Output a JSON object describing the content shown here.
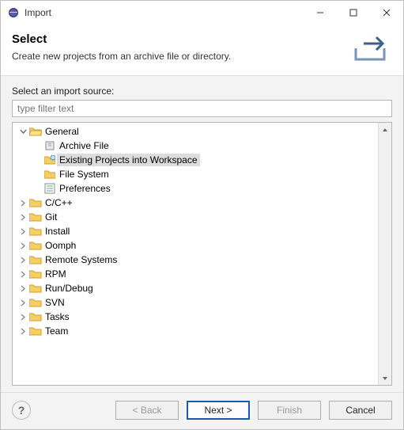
{
  "window": {
    "title": "Import"
  },
  "banner": {
    "heading": "Select",
    "subheading": "Create new projects from an archive file or directory."
  },
  "content": {
    "label": "Select an import source:",
    "filter_placeholder": "type filter text"
  },
  "tree": {
    "general": {
      "label": "General",
      "children": [
        {
          "label": "Archive File",
          "icon": "archive-file-icon"
        },
        {
          "label": "Existing Projects into Workspace",
          "icon": "projects-icon",
          "selected": true
        },
        {
          "label": "File System",
          "icon": "file-system-icon"
        },
        {
          "label": "Preferences",
          "icon": "preferences-icon"
        }
      ]
    },
    "folders": [
      {
        "label": "C/C++"
      },
      {
        "label": "Git"
      },
      {
        "label": "Install"
      },
      {
        "label": "Oomph"
      },
      {
        "label": "Remote Systems"
      },
      {
        "label": "RPM"
      },
      {
        "label": "Run/Debug"
      },
      {
        "label": "SVN"
      },
      {
        "label": "Tasks"
      },
      {
        "label": "Team"
      }
    ]
  },
  "buttons": {
    "back": "< Back",
    "next": "Next >",
    "finish": "Finish",
    "cancel": "Cancel"
  }
}
